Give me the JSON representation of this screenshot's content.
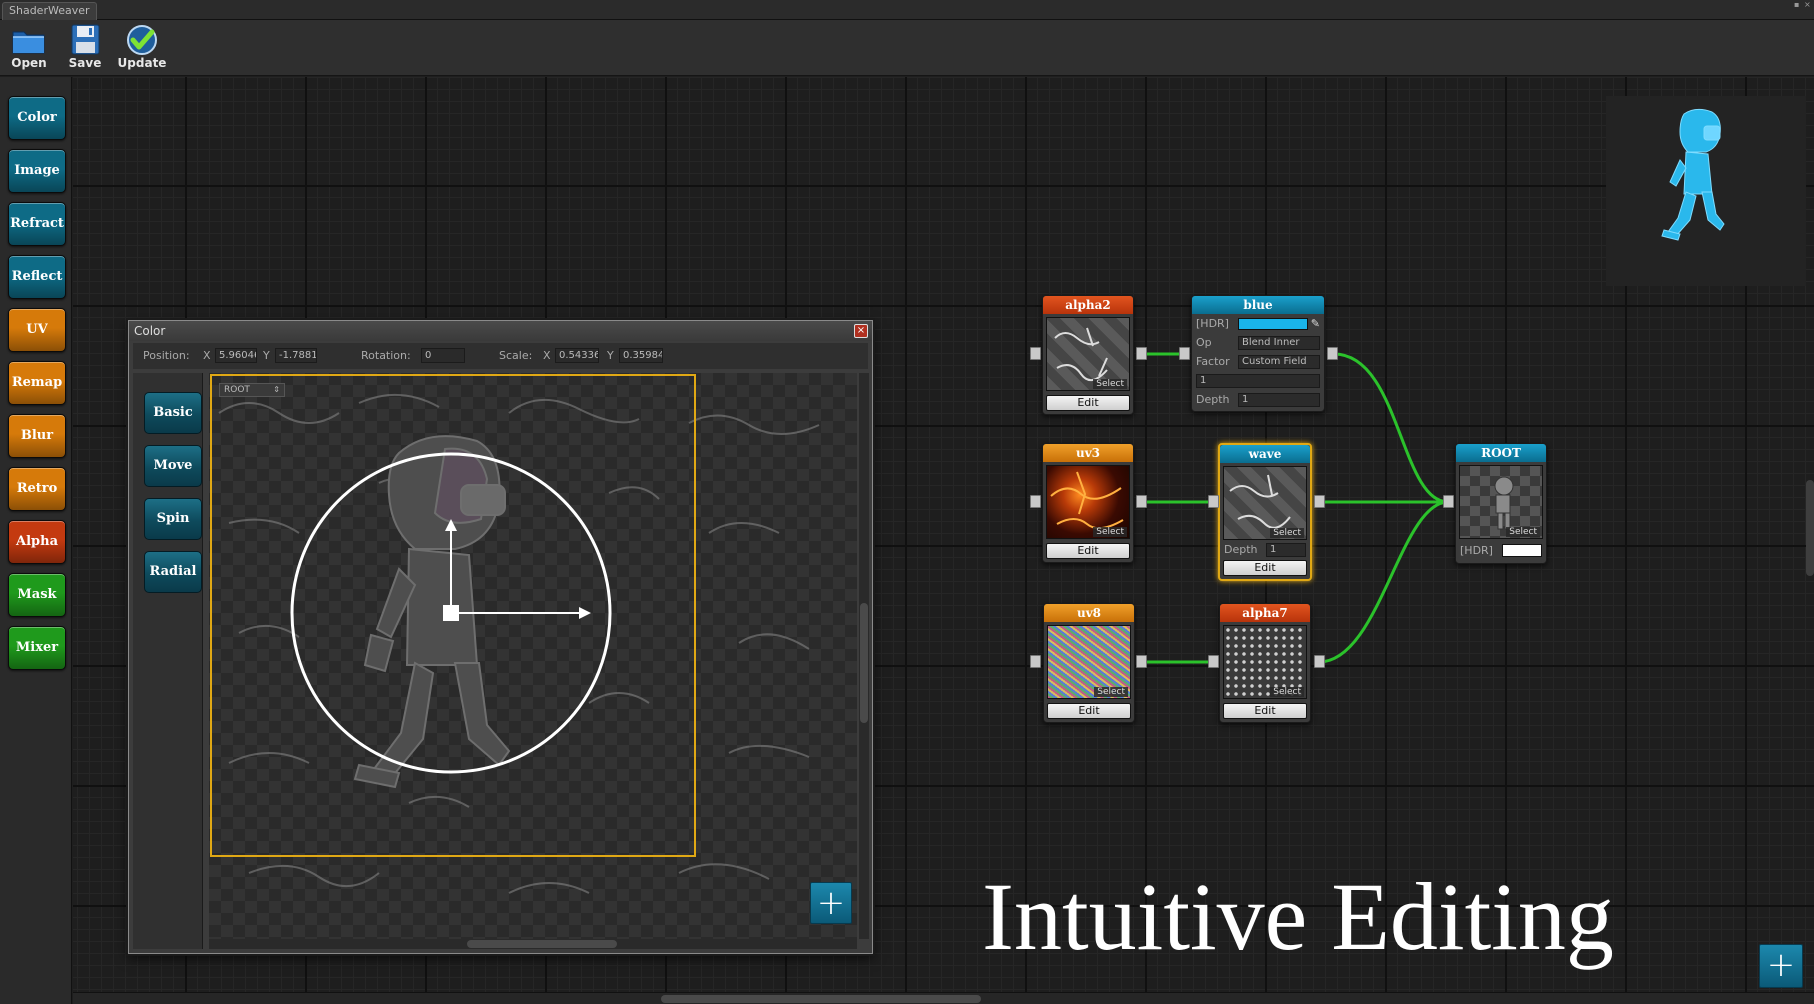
{
  "app": {
    "window_title": "ShaderWeaver"
  },
  "toolbar": {
    "open_label": "Open",
    "save_label": "Save",
    "update_label": "Update"
  },
  "palette": {
    "items": [
      {
        "label": "Color",
        "color": "#0e6b86"
      },
      {
        "label": "Image",
        "color": "#0e6b86"
      },
      {
        "label": "Refract",
        "color": "#0e6b86"
      },
      {
        "label": "Reflect",
        "color": "#0e6b86"
      },
      {
        "label": "UV",
        "color": "#d67a0a"
      },
      {
        "label": "Remap",
        "color": "#d67a0a"
      },
      {
        "label": "Blur",
        "color": "#d67a0a"
      },
      {
        "label": "Retro",
        "color": "#d67a0a"
      },
      {
        "label": "Alpha",
        "color": "#c43a10"
      },
      {
        "label": "Mask",
        "color": "#1f9a1c"
      },
      {
        "label": "Mixer",
        "color": "#1f9a1c"
      }
    ]
  },
  "dialog": {
    "title": "Color",
    "close_icon": "x",
    "position_label": "Position:",
    "x_label": "X",
    "y_label": "Y",
    "pos_x": "5.96046",
    "pos_y": "-1.7881",
    "rotation_label": "Rotation:",
    "rotation": "0",
    "scale_label": "Scale:",
    "scale_x_label": "X",
    "scale_y_label": "Y",
    "scale_x": "0.54336",
    "scale_y": "0.35984",
    "layer_select": "ROOT",
    "tabs": [
      "Basic",
      "Move",
      "Spin",
      "Radial"
    ]
  },
  "nodes": {
    "alpha2": {
      "title": "alpha2",
      "select": "Select",
      "edit": "Edit",
      "color": "#d2400f"
    },
    "blue": {
      "title": "blue",
      "hdr_label": "[HDR]",
      "op_label": "Op",
      "op_value": "Blend Inner",
      "factor_label": "Factor",
      "factor_value": "Custom Field",
      "custom_value": "1",
      "depth_label": "Depth",
      "depth_value": "1",
      "color": "#0b7fa5",
      "swatch": "#1ab4ea"
    },
    "uv3": {
      "title": "uv3",
      "select": "Select",
      "edit": "Edit",
      "color": "#e08614"
    },
    "wave": {
      "title": "wave",
      "select": "Select",
      "depth_label": "Depth",
      "depth_value": "1",
      "edit": "Edit",
      "color": "#0b7fa5"
    },
    "root": {
      "title": "ROOT",
      "select": "Select",
      "hdr_label": "[HDR]",
      "color": "#0b7fa5"
    },
    "uv8": {
      "title": "uv8",
      "select": "Select",
      "edit": "Edit",
      "color": "#e08614"
    },
    "alpha7": {
      "title": "alpha7",
      "select": "Select",
      "edit": "Edit",
      "color": "#d2400f"
    }
  },
  "caption": "Intuitive Editing",
  "icons": {
    "open": "folder-icon",
    "save": "floppy-disk-icon",
    "update": "checkmark-icon",
    "add": "plus-icon"
  },
  "colors": {
    "wire": "#2bc22b",
    "selection": "#e0a814",
    "preview_character": "#2ab8ec"
  }
}
